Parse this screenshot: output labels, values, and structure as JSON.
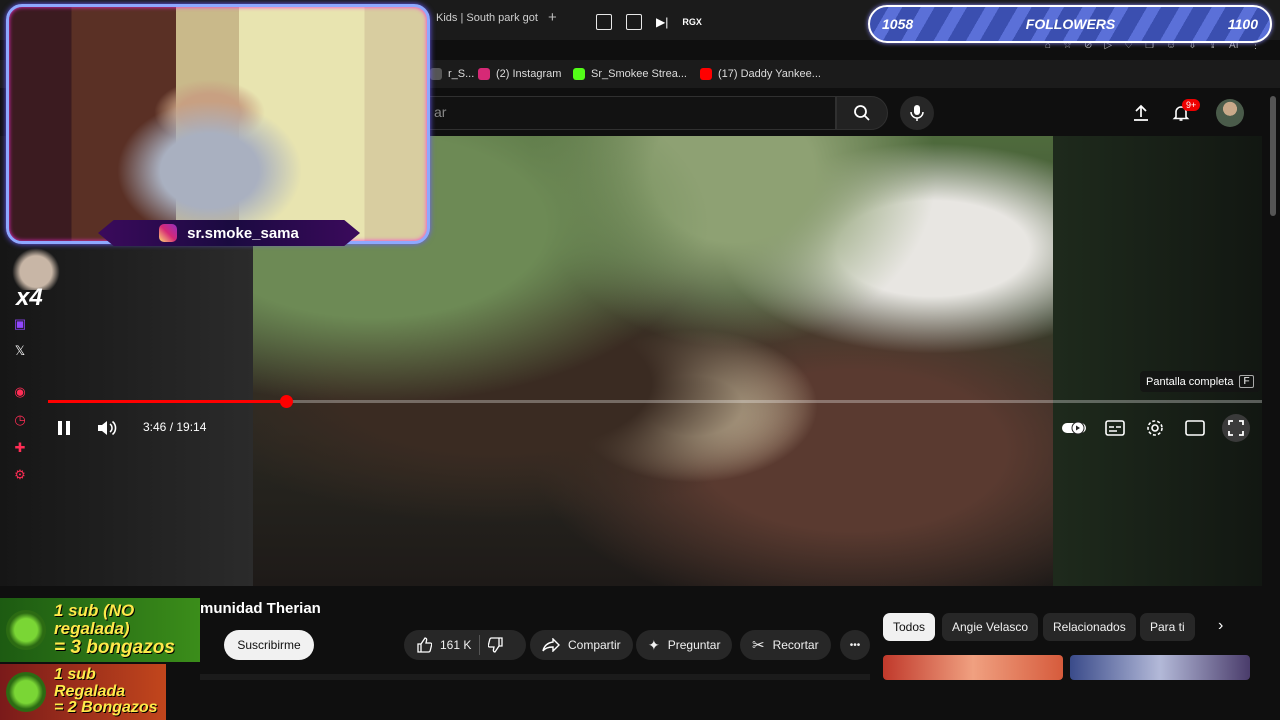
{
  "browser": {
    "tab_title": "Kids | South park got",
    "new_tab": "+",
    "bookmarks": [
      {
        "label": "r_S...",
        "color": "#8a8a8a"
      },
      {
        "label": "(2) Instagram",
        "color": "#d62976"
      },
      {
        "label": "Sr_Smokee Strea...",
        "color": "#53fc18"
      },
      {
        "label": "(17) Daddy Yankee...",
        "color": "#ff0000"
      }
    ],
    "ext_ai_label": "AI"
  },
  "header": {
    "search_placeholder": "ar",
    "notifications_badge": "9+"
  },
  "player": {
    "overlay_label": "RGX",
    "current_time": "3:46 / 19:14",
    "progress_fraction": 0.196,
    "tooltip": "Pantalla completa",
    "tooltip_key": "F"
  },
  "video": {
    "title": "munidad Therian",
    "subscribe_label": "Suscribirme",
    "like_count": "161 K",
    "share_label": "Compartir",
    "ask_label": "Preguntar",
    "clip_label": "Recortar",
    "more_label": "•••"
  },
  "chips": [
    "Todos",
    "Angie Velasco",
    "Relacionados",
    "Para ti"
  ],
  "stream_overlay": {
    "handle": "sr.smoke_sama",
    "multiplier": "x4",
    "followers_current": "1058",
    "followers_label": "FOLLOWERS",
    "followers_goal": "1100",
    "promo_1_line1": "1 sub (NO regalada)",
    "promo_1_line2": "= 3 bongazos",
    "promo_2_line1": "1 sub Regalada",
    "promo_2_line2": "= 2 Bongazos"
  },
  "colors": {
    "accent": "#ff0000",
    "background": "#0f0f0f",
    "followers_bar": "#4a5fc8"
  }
}
